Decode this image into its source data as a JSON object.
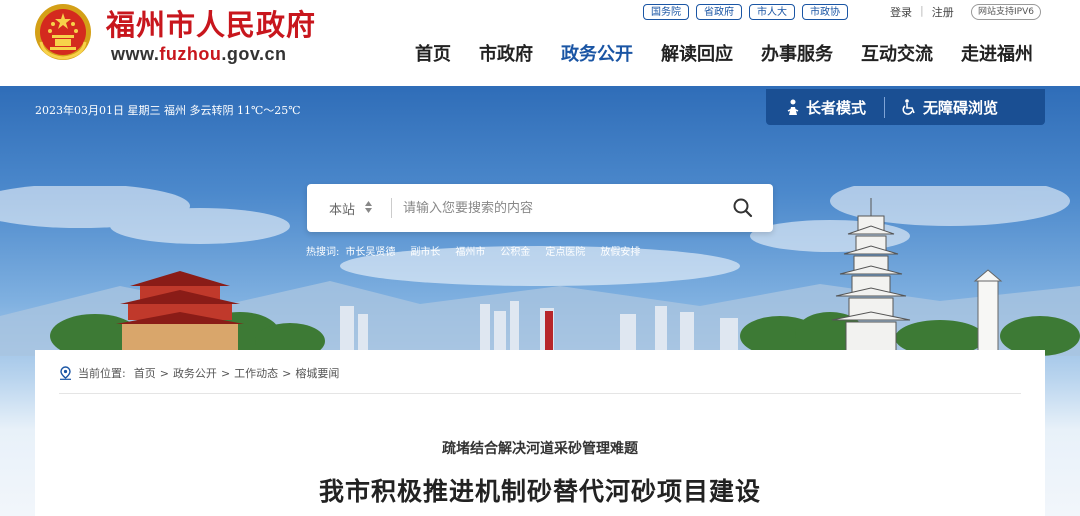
{
  "header": {
    "site_name": "福州市人民政府",
    "domain_prefix": "www.",
    "domain_main": "fuzhou",
    "domain_suffix": ".gov.cn",
    "top_links": [
      "国务院",
      "省政府",
      "市人大",
      "市政协"
    ],
    "login": "登录",
    "separator": "|",
    "register": "注册",
    "ipv6": "网站支持IPV6",
    "nav": [
      "首页",
      "市政府",
      "政务公开",
      "解读回应",
      "办事服务",
      "互动交流",
      "走进福州"
    ],
    "active_nav": "政务公开"
  },
  "banner": {
    "date_line": "2023年03月01日 星期三 福州 多云转阴 11℃～25℃",
    "elder_mode": "长者模式",
    "accessible": "无障碍浏览",
    "search": {
      "scope": "本站",
      "placeholder": "请输入您要搜索的内容"
    },
    "hot_label": "热搜词:",
    "hot_words": [
      "市长吴贤德",
      "副市长",
      "福州市",
      "公积金",
      "定点医院",
      "放假安排"
    ]
  },
  "article": {
    "breadcrumb_label": "当前位置:",
    "breadcrumb": [
      "首页",
      "政务公开",
      "工作动态",
      "榕城要闻"
    ],
    "breadcrumb_sep": ">",
    "subtitle": "疏堵结合解决河道采砂管理难题",
    "title": "我市积极推进机制砂替代河砂项目建设"
  },
  "colors": {
    "brand_red": "#c8161d",
    "brand_blue": "#1a55a4",
    "mode_bar": "#1a4f93"
  },
  "icons": [
    "national-emblem-icon",
    "elder-icon",
    "wheelchair-icon",
    "sort-arrows-icon",
    "search-icon",
    "location-pin-icon"
  ]
}
